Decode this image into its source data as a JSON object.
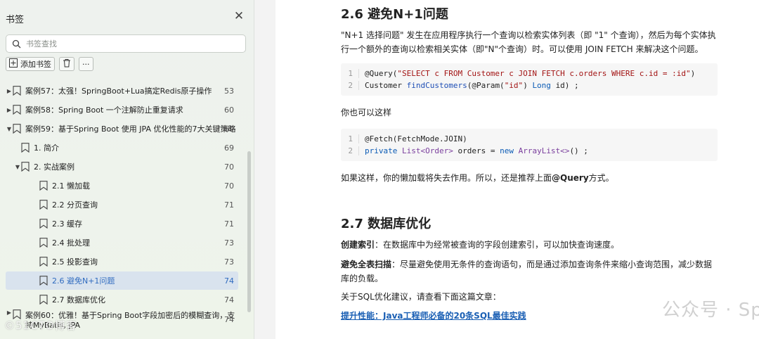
{
  "sidebar": {
    "title": "书签",
    "search_placeholder": "书签查找",
    "add_bookmark_label": "添加书签",
    "items": [
      {
        "label": "案例57：太强！SpringBoot+Lua搞定Redis原子操作",
        "page": "53",
        "arrow": "▶",
        "level": 0
      },
      {
        "label": "案例58：Spring Boot 一个注解防止重复请求",
        "page": "60",
        "arrow": "▶",
        "level": 0
      },
      {
        "label": "案例59：基于Spring Boot 使用 JPA 优化性能的7大关键策略",
        "page": "69",
        "arrow": "▼",
        "level": 0
      },
      {
        "label": "1. 简介",
        "page": "69",
        "arrow": "",
        "level": 1
      },
      {
        "label": "2. 实战案例",
        "page": "70",
        "arrow": "▼",
        "level": 1
      },
      {
        "label": "2.1 懒加载",
        "page": "70",
        "arrow": "",
        "level": 2
      },
      {
        "label": "2.2 分页查询",
        "page": "71",
        "arrow": "",
        "level": 2
      },
      {
        "label": "2.3 缓存",
        "page": "71",
        "arrow": "",
        "level": 2
      },
      {
        "label": "2.4 批处理",
        "page": "73",
        "arrow": "",
        "level": 2
      },
      {
        "label": "2.5 投影查询",
        "page": "73",
        "arrow": "",
        "level": 2
      },
      {
        "label": "2.6 避免N+1问题",
        "page": "74",
        "arrow": "",
        "level": 2,
        "active": true
      },
      {
        "label": "2.7 数据库优化",
        "page": "74",
        "arrow": "",
        "level": 2
      },
      {
        "label": "案例60：优雅！基于Spring Boot字段加密后的模糊查询，支持MyBatis, JPA",
        "page": "74",
        "arrow": "▶",
        "level": 0
      }
    ],
    "watermark": "©51CTO博客"
  },
  "doc": {
    "section1_title": "2.6 避免N+1问题",
    "section1_para": "\"N+1 选择问题\" 发生在应用程序执行一个查询以检索实体列表（即 \"1\" 个查询），然后为每个实体执行一个额外的查询以检索相关实体（即\"N\"个查询）时。可以使用 JOIN FETCH 来解决这个问题。",
    "code1": {
      "line1_ann": "@Query(",
      "line1_str": "\"SELECT c FROM Customer c JOIN FETCH c.orders WHERE c.id = :id\"",
      "line1_end": ")",
      "line2_type": "Customer",
      "line2_fn": "findCustomers",
      "line2_mid": "(@Param(",
      "line2_str": "\"id\"",
      "line2_type2": "Long",
      "line2_end": "id) ;"
    },
    "you_can": "你也可以这样",
    "code2": {
      "line1": "@Fetch(FetchMode.JOIN)",
      "line2_kw": "private",
      "line2_type": "List<Order>",
      "line2_var": "orders =",
      "line2_new": "new",
      "line2_type2": "ArrayList<>",
      "line2_end": "() ;"
    },
    "lazy_note_prefix": "如果这样，你的懒加载将失去作用。所以，还是推荐上面",
    "lazy_note_bold": "@Query",
    "lazy_note_suffix": "方式。",
    "section2_title": "2.7 数据库优化",
    "index_label": "创建索引",
    "index_text": "：在数据库中为经常被查询的字段创建索引，可以加快查询速度。",
    "scan_label": "避免全表扫描",
    "scan_text": "：尽量避免使用无条件的查询语句，而是通过添加查询条件来缩小查询范围，减少数据库的负载。",
    "sql_advice": "关于SQL优化建议，请查看下面这篇文章：",
    "article_link": "提升性能：Java工程师必备的20条SQL最佳实践",
    "watermark": "公众号 · Spring全家桶实战案例源码"
  },
  "colors": {
    "active_bg": "#d9e3ee",
    "active_text": "#2f6bbf",
    "link": "#1a5fb4"
  }
}
